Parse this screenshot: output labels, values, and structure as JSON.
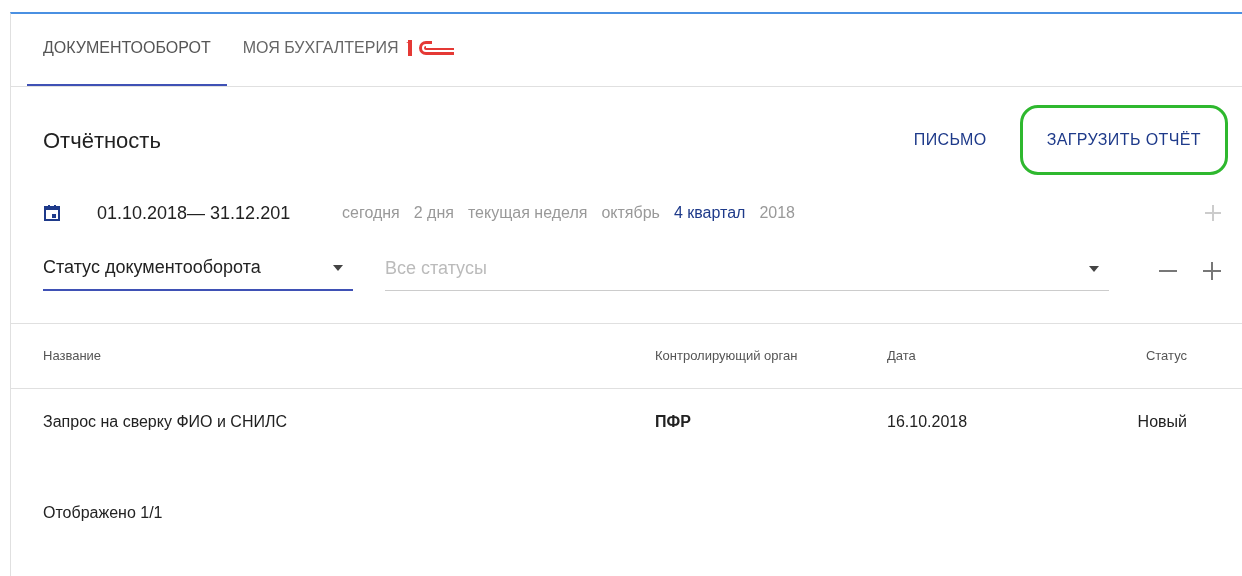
{
  "tabs": [
    {
      "label": "ДОКУМЕНТООБОРОТ",
      "selected": true,
      "logo": false
    },
    {
      "label": "МОЯ БУХГАЛТЕРИЯ",
      "selected": false,
      "logo": true
    }
  ],
  "title": "Отчётность",
  "actions": [
    {
      "label": "ПИСЬМО",
      "highlighted": false
    },
    {
      "label": "ЗАГРУЗИТЬ ОТЧЁТ",
      "highlighted": true
    }
  ],
  "date_range": "01.10.2018— 31.12.201",
  "periods": [
    {
      "label": "сегодня",
      "selected": false
    },
    {
      "label": "2 дня",
      "selected": false
    },
    {
      "label": "текущая неделя",
      "selected": false
    },
    {
      "label": "октябрь",
      "selected": false
    },
    {
      "label": "4 квартал",
      "selected": true
    },
    {
      "label": "2018",
      "selected": false
    }
  ],
  "filter": {
    "field": "Статус документооборота",
    "placeholder": "Все статусы"
  },
  "table": {
    "columns": [
      "Название",
      "Контролирующий орган",
      "Дата",
      "Статус"
    ],
    "rows": [
      [
        "Запрос на сверку ФИО и СНИЛС",
        "ПФР",
        "16.10.2018",
        "Новый"
      ]
    ]
  },
  "footer": "Отображено 1/1"
}
